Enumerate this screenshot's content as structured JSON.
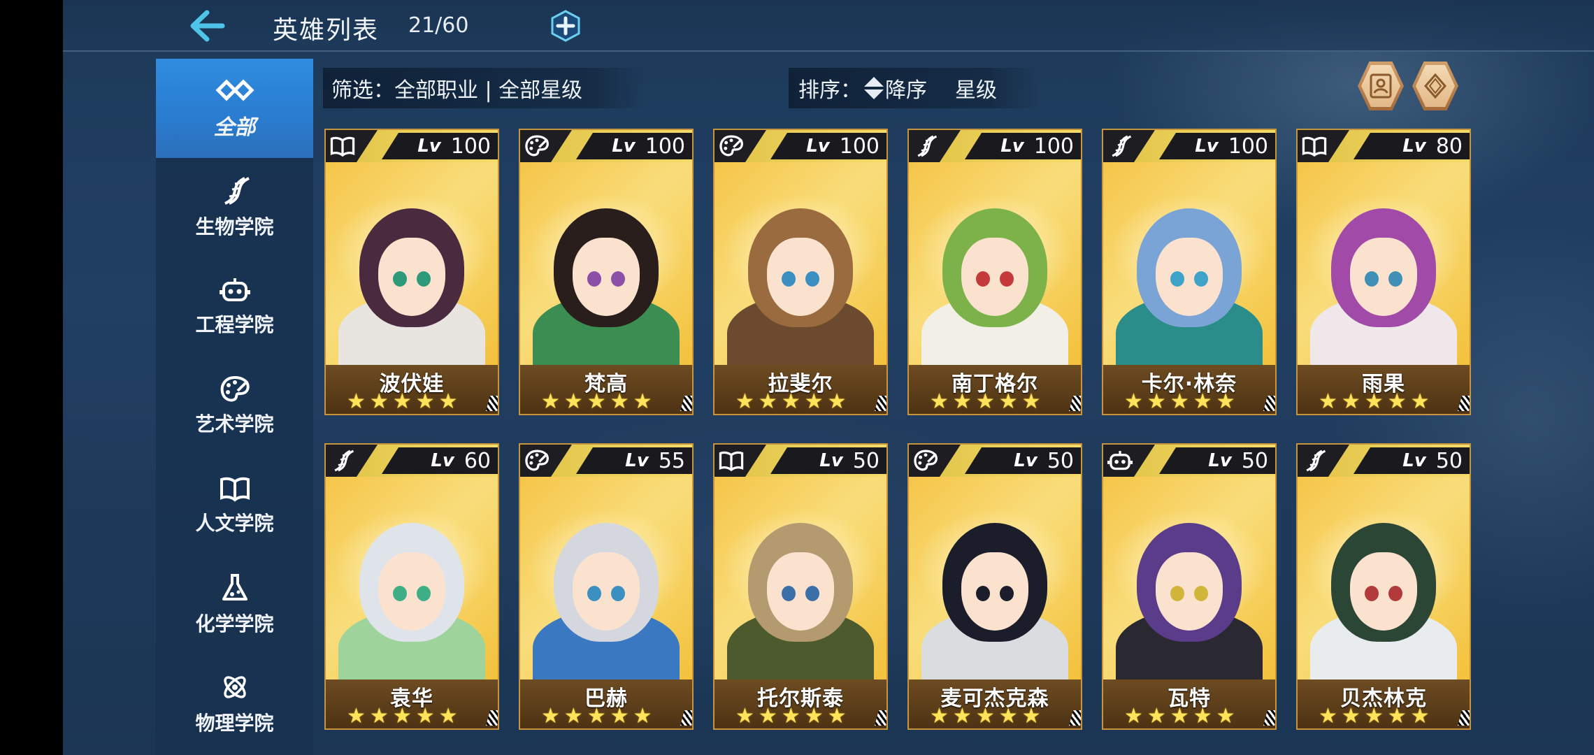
{
  "header": {
    "title": "英雄列表",
    "count": "21/60"
  },
  "sidebar": {
    "items": [
      {
        "label": "全部",
        "icon": "infinity-icon",
        "active": true
      },
      {
        "label": "生物学院",
        "icon": "dna-icon"
      },
      {
        "label": "工程学院",
        "icon": "robot-icon"
      },
      {
        "label": "艺术学院",
        "icon": "palette-icon"
      },
      {
        "label": "人文学院",
        "icon": "book-icon"
      },
      {
        "label": "化学学院",
        "icon": "flask-icon"
      },
      {
        "label": "物理学院",
        "icon": "atom-icon"
      }
    ]
  },
  "filter": {
    "text": "筛选：全部职业 | 全部星级"
  },
  "sort": {
    "label": "排序：",
    "order": "降序",
    "key": "星级"
  },
  "heroes": [
    {
      "name": "波伏娃",
      "level": "100",
      "stars": 5,
      "class_icon": "book-icon",
      "hair": "#4a2a3e",
      "outfit": "#e8e4e0",
      "eye": "#2f9a7a"
    },
    {
      "name": "梵高",
      "level": "100",
      "stars": 5,
      "class_icon": "palette-icon",
      "hair": "#2a1e1c",
      "outfit": "#3b8d52",
      "eye": "#8b4fa8"
    },
    {
      "name": "拉斐尔",
      "level": "100",
      "stars": 5,
      "class_icon": "palette-icon",
      "hair": "#9a6b3f",
      "outfit": "#6b4a2f",
      "eye": "#3b8fc1"
    },
    {
      "name": "南丁格尔",
      "level": "100",
      "stars": 5,
      "class_icon": "dna-icon",
      "hair": "#7db24a",
      "outfit": "#f2efe6",
      "eye": "#c43a3a"
    },
    {
      "name": "卡尔·林奈",
      "level": "100",
      "stars": 5,
      "class_icon": "dna-icon",
      "hair": "#7aa4d6",
      "outfit": "#2b8d8a",
      "eye": "#3fa2c9"
    },
    {
      "name": "雨果",
      "level": "80",
      "stars": 5,
      "class_icon": "book-icon",
      "hair": "#a14aa8",
      "outfit": "#f0e7ea",
      "eye": "#3f8fb6"
    },
    {
      "name": "袁华",
      "level": "60",
      "stars": 5,
      "class_icon": "dna-icon",
      "hair": "#dfe4ea",
      "outfit": "#9ed49c",
      "eye": "#3fae86"
    },
    {
      "name": "巴赫",
      "level": "55",
      "stars": 5,
      "class_icon": "palette-icon",
      "hair": "#d4d8de",
      "outfit": "#3a78c2",
      "eye": "#3b8fc1"
    },
    {
      "name": "托尔斯泰",
      "level": "50",
      "stars": 5,
      "class_icon": "book-icon",
      "hair": "#b39a6f",
      "outfit": "#4c5a2e",
      "eye": "#3b6fa8"
    },
    {
      "name": "麦可杰克森",
      "level": "50",
      "stars": 5,
      "class_icon": "palette-icon",
      "hair": "#1c1d2a",
      "outfit": "#d9dde0",
      "eye": "#1c1d2a"
    },
    {
      "name": "瓦特",
      "level": "50",
      "stars": 5,
      "class_icon": "robot-icon",
      "hair": "#5b3c8a",
      "outfit": "#2a2830",
      "eye": "#d1b43a"
    },
    {
      "name": "贝杰林克",
      "level": "50",
      "stars": 5,
      "class_icon": "dna-icon",
      "hair": "#2c4636",
      "outfit": "#e9ecef",
      "eye": "#b23a3a"
    }
  ],
  "colors": {
    "accent_blue": "#2f8de0",
    "card_gold": "#f5c548",
    "star_yellow": "#ffe35a"
  }
}
